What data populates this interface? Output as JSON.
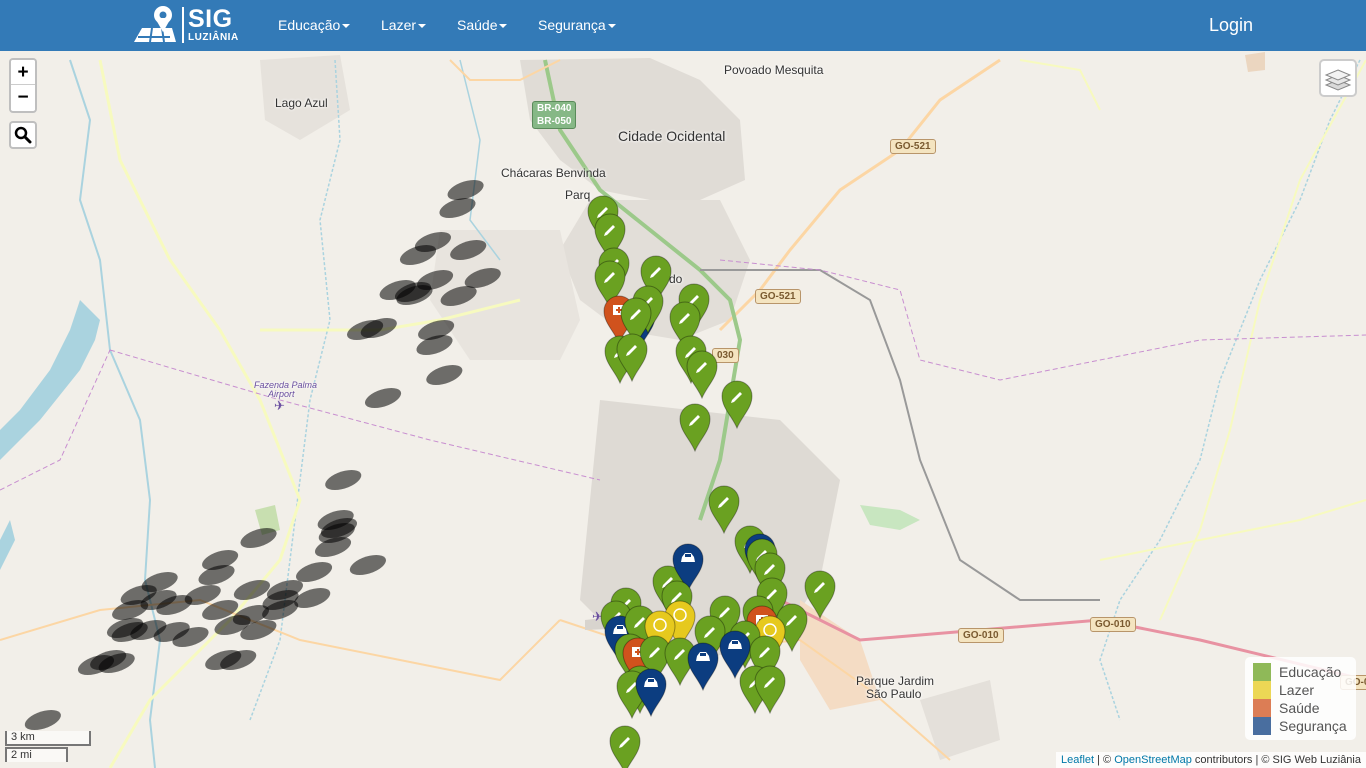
{
  "brand": {
    "title": "SIG",
    "subtitle": "LUZIÂNIA"
  },
  "nav": {
    "items": [
      {
        "label": "Educação"
      },
      {
        "label": "Lazer"
      },
      {
        "label": "Saúde"
      },
      {
        "label": "Segurança"
      }
    ],
    "login": "Login"
  },
  "controls": {
    "zoom_in": "+",
    "zoom_out": "−"
  },
  "map_labels": {
    "povoado": "Povoado Mesquita",
    "lago_azul": "Lago Azul",
    "cidade_ocidental": "Cidade Ocidental",
    "chacaras": "Chácaras Benvinda",
    "parque_jardim_1": "Parque Jardim",
    "parque_jardim_2": "São Paulo",
    "fazenda_1": "Fazenda Palma",
    "fazenda_2": "Airport",
    "parq": "Parq",
    "do": "do"
  },
  "road_shields": {
    "br040": "BR-040",
    "br050": "BR-050",
    "go521_top": "GO-521",
    "go521_mid": "GO-521",
    "go010_left": "GO-010",
    "go010_right": "GO-010",
    "go_edge": "GO-0",
    "road_030": "030"
  },
  "legend": {
    "items": [
      {
        "label": "Educação",
        "color": "#6aa121"
      },
      {
        "label": "Lazer",
        "color": "#e6c91e"
      },
      {
        "label": "Saúde",
        "color": "#d0521d"
      },
      {
        "label": "Segurança",
        "color": "#0c3d80"
      }
    ]
  },
  "scale": {
    "km": "3 km",
    "mi": "2 mi"
  },
  "attribution": {
    "leaflet": "Leaflet",
    "sep1": " | © ",
    "osm": "OpenStreetMap",
    "rest": " contributors | © SIG Web Luziânia"
  },
  "marker_colors": {
    "educacao": "#6aa121",
    "lazer": "#e6c91e",
    "saude": "#d0521d",
    "seguranca": "#0c3d80"
  },
  "marker_icons": {
    "educacao": "pencil-icon",
    "lazer": "smile-icon",
    "saude": "medkit-icon",
    "seguranca": "police-car-icon"
  }
}
